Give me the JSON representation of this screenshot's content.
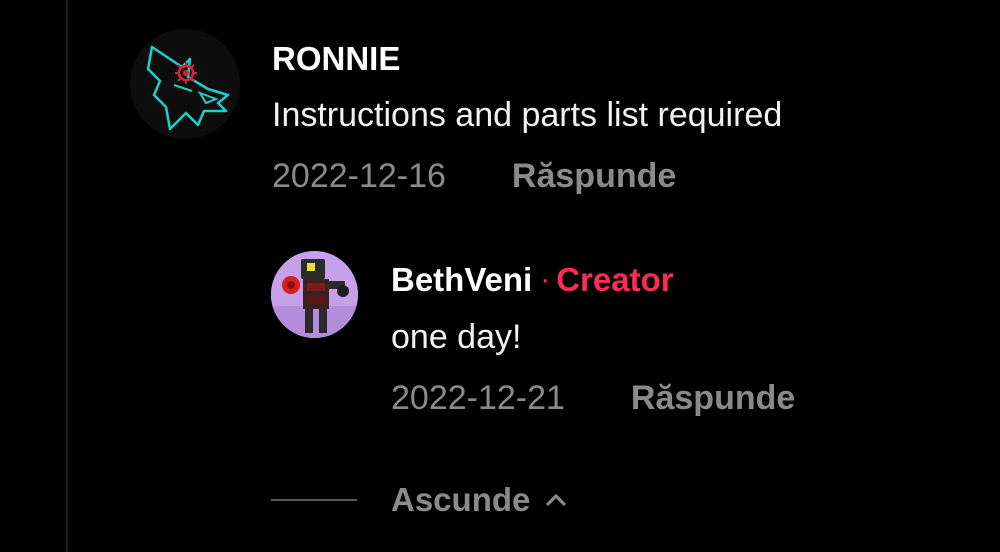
{
  "comments": [
    {
      "username": "RONNIE",
      "text": "Instructions and parts list required",
      "date": "2022-12-16",
      "reply_label": "Răspunde",
      "avatar": "wolf-neon-avatar"
    }
  ],
  "reply": {
    "username": "BethVeni",
    "separator": "·",
    "badge": "Creator",
    "text": "one day!",
    "date": "2022-12-21",
    "reply_label": "Răspunde",
    "avatar": "robot-avatar"
  },
  "hide_replies": {
    "label": "Ascunde",
    "icon": "chevron-up-icon"
  },
  "colors": {
    "background": "#000000",
    "accent_creator": "#fe2c55",
    "muted_text": "#8a8a8a"
  }
}
